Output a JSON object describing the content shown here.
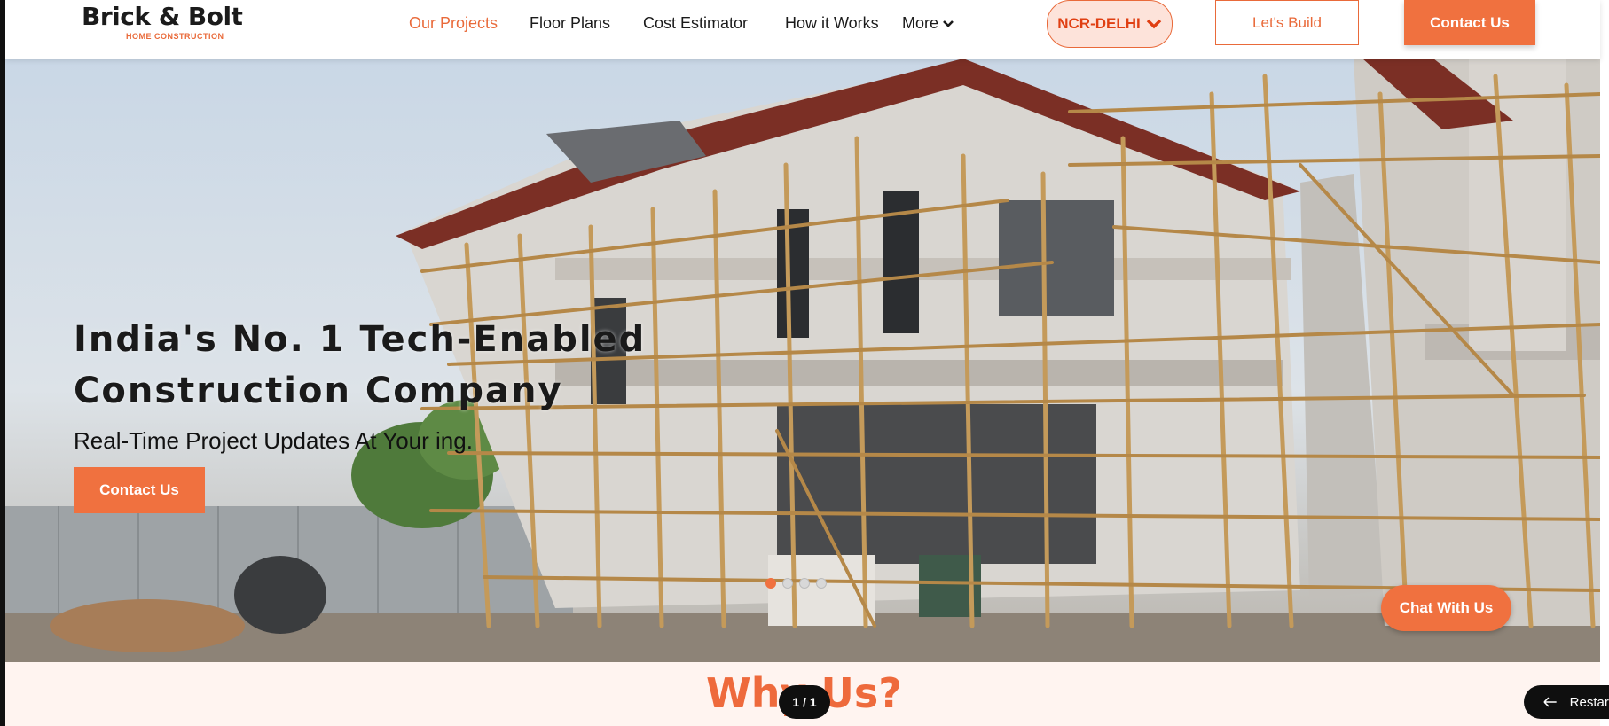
{
  "header": {
    "logo_main": "Brick & Bolt",
    "logo_sub": "HOME CONSTRUCTION",
    "nav": [
      {
        "label": "Our Projects",
        "active": true
      },
      {
        "label": "Floor Plans"
      },
      {
        "label": "Cost Estimator"
      },
      {
        "label": "How it Works"
      },
      {
        "label": "More"
      }
    ],
    "region": "NCR-DELHI",
    "lets_build": "Let's Build",
    "contact": "Contact Us"
  },
  "hero": {
    "title_line1": "India's No. 1 Tech-Enabled",
    "title_line2": "Construction Company",
    "subtitle": "Real-Time Project Updates At Your ing.",
    "cta": "Contact Us",
    "slide_count": 4,
    "active_slide": 1,
    "chat": "Chat With Us"
  },
  "why": {
    "title": "Why Us?"
  },
  "overlay": {
    "pager": "1 / 1",
    "restart": "Restart"
  },
  "colors": {
    "accent": "#f0713f",
    "region_bg": "#fde3da",
    "why_bg": "#fff4f0"
  }
}
